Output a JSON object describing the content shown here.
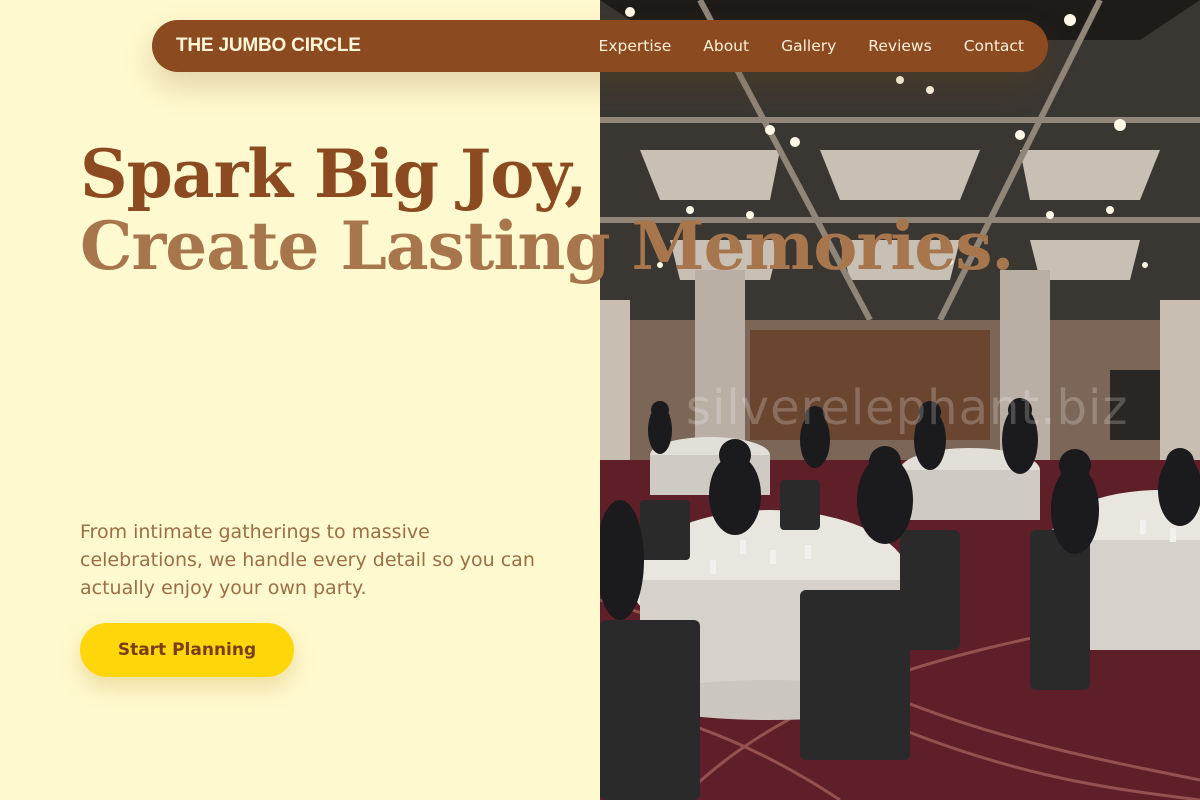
{
  "brand": "THE JUMBO CIRCLE",
  "nav": {
    "links": [
      "Expertise",
      "About",
      "Gallery",
      "Reviews",
      "Contact"
    ]
  },
  "hero": {
    "title_line1": "Spark Big Joy,",
    "title_line2": "Create Lasting Memories.",
    "subtitle": "From intimate gatherings to massive celebrations, we handle every detail so you can actually enjoy your own party.",
    "cta_label": "Start Planning"
  },
  "photo": {
    "watermark": "silverelephant.biz",
    "alt": "banquet hall with round tables"
  },
  "colors": {
    "background": "#FFF9CF",
    "brand_brown": "#8B4A1F",
    "title_light": "#A8764D",
    "cta_yellow": "#FFD60A"
  }
}
